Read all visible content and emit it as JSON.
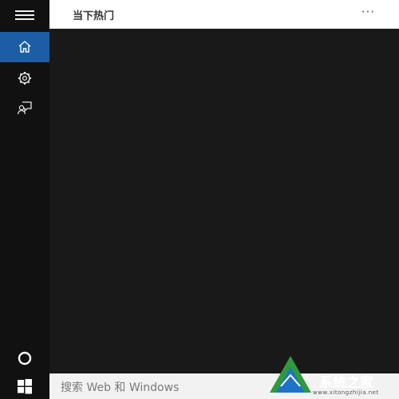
{
  "header": {
    "title": "当下热门",
    "more": "···"
  },
  "sidebar": {
    "items": [
      {
        "name": "home",
        "icon": "home-icon",
        "active": true
      },
      {
        "name": "settings",
        "icon": "gear-icon",
        "active": false
      },
      {
        "name": "feedback",
        "icon": "feedback-icon",
        "active": false
      },
      {
        "name": "cortana",
        "icon": "cortana-circle-icon",
        "active": false
      }
    ]
  },
  "search": {
    "placeholder": "搜索 Web 和 Windows"
  },
  "watermark": {
    "text": "系统之家",
    "url": "www.xitongzhijia.net"
  },
  "colors": {
    "sidebar_bg": "#111111",
    "content_bg": "#191919",
    "accent": "#1c5ea5",
    "header_bg": "#ffffff",
    "search_bg": "#f2f2f2"
  }
}
